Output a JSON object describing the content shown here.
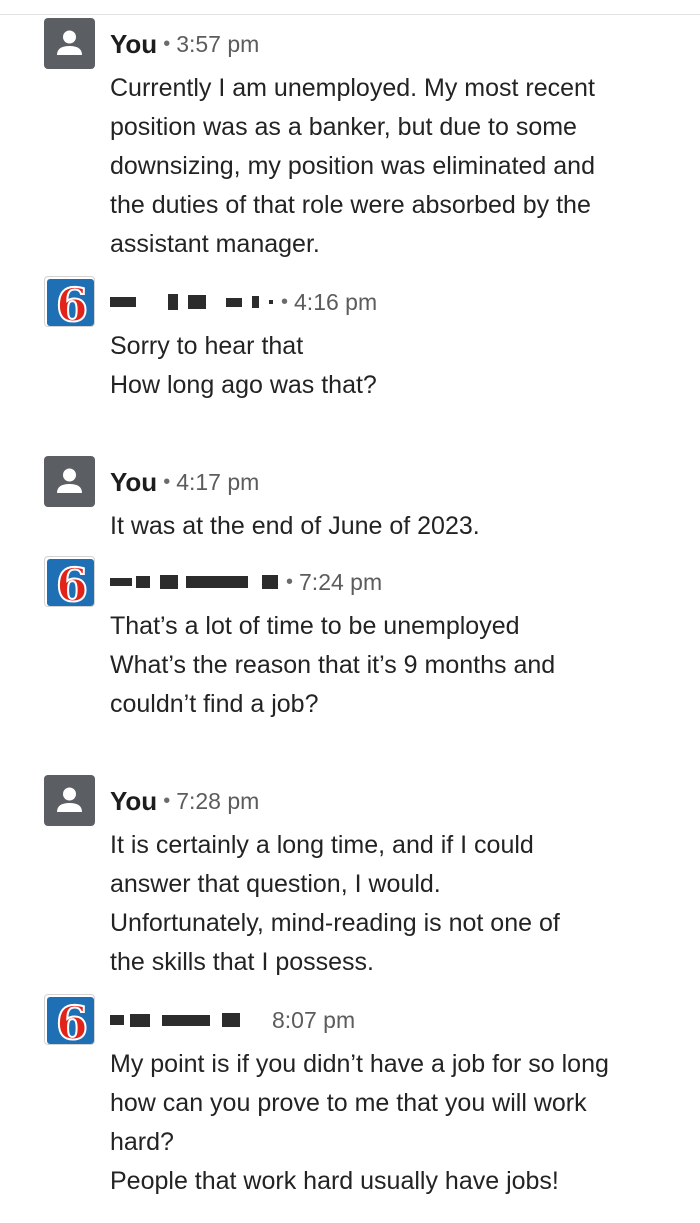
{
  "messages": [
    {
      "author": "You",
      "avatar_icon": "person-icon",
      "time": "3:57 pm",
      "lines": [
        "Currently I am unemployed. My most recent",
        "position was as a banker, but due to some",
        "downsizing, my position was eliminated and",
        "the duties of that role were absorbed by the",
        "assistant manager."
      ]
    },
    {
      "author_redacted": true,
      "avatar_icon": "motel6-logo-icon",
      "time": "4:16 pm",
      "lines": [
        "Sorry to hear that",
        "How long ago was that?"
      ]
    },
    {
      "author": "You",
      "avatar_icon": "person-icon",
      "time": "4:17 pm",
      "lines": [
        "It was at the end of June of 2023."
      ]
    },
    {
      "author_redacted": true,
      "avatar_icon": "motel6-logo-icon",
      "time": "7:24 pm",
      "lines": [
        "That’s a lot of time to be unemployed",
        "What’s the reason that it’s 9 months and",
        "couldn’t find a job?"
      ]
    },
    {
      "author": "You",
      "avatar_icon": "person-icon",
      "time": "7:28 pm",
      "lines": [
        "It is certainly a long time, and if I could",
        "answer that question, I would.",
        "Unfortunately, mind-reading is not one of",
        "the skills that I possess."
      ]
    },
    {
      "author_redacted": true,
      "avatar_icon": "motel6-logo-icon",
      "time": "8:07 pm",
      "lines": [
        "My point is  if you didn’t have a job for so long",
        "how can you prove to me that you will work",
        "hard?",
        "People that work hard usually have jobs!"
      ]
    }
  ],
  "separator": "•",
  "colors": {
    "user_avatar_bg": "#5b5f63",
    "motel6_blue": "#1f6fb5",
    "motel6_red": "#e2231a"
  }
}
